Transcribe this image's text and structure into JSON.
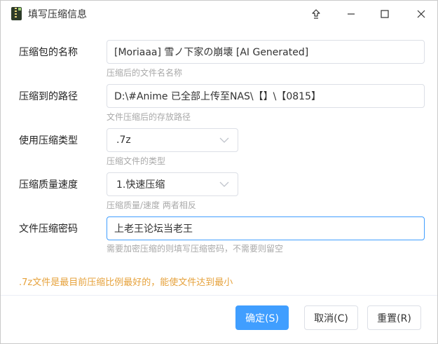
{
  "window": {
    "title": "填写压缩信息",
    "icons": {
      "app": "archive-app-icon",
      "pin": "pin-icon",
      "minimize": "minimize-icon",
      "maximize": "maximize-icon",
      "close": "close-icon"
    }
  },
  "form": {
    "name": {
      "label": "压缩包的名称",
      "value": "[Moriaaa] 雪ノ下家の崩壊 [AI Generated]",
      "hint": "压缩后的文件名名称"
    },
    "path": {
      "label": "压缩到的路径",
      "value": "D:\\#Anime 已全部上传至NAS\\【】\\【0815】",
      "hint": "文件压缩后的存放路径"
    },
    "type": {
      "label": "使用压缩类型",
      "value": ".7z",
      "hint": "压缩文件的类型"
    },
    "speed": {
      "label": "压缩质量速度",
      "value": "1.快速压缩",
      "hint": "压缩质量/速度 两者相反"
    },
    "password": {
      "label": "文件压缩密码",
      "value": "上老王论坛当老王",
      "hint": "需要加密压缩的则填写压缩密码，不需要则留空"
    }
  },
  "note": ".7z文件是最目前压缩比例最好的，能使文件达到最小",
  "buttons": {
    "confirm": "确定(S)",
    "cancel": "取消(C)",
    "reset": "重置(R)"
  },
  "colors": {
    "primary": "#409eff",
    "note": "#e6a23c",
    "hint": "#a9a9a9",
    "border": "#dcdfe6"
  }
}
